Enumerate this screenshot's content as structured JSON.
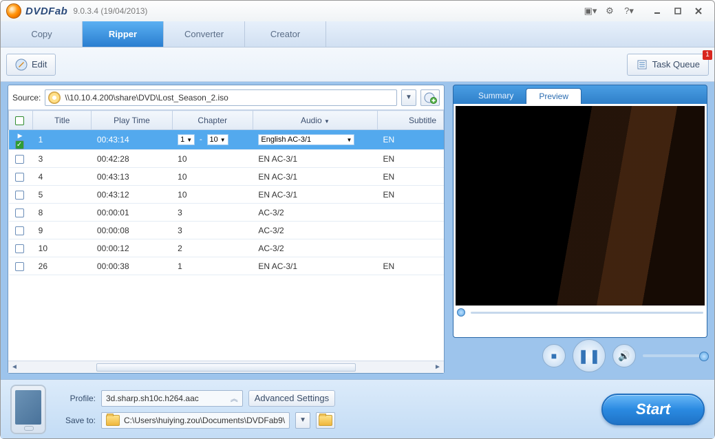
{
  "app": {
    "name": "DVDFab",
    "version": "9.0.3.4 (19/04/2013)"
  },
  "mainTabs": [
    "Copy",
    "Ripper",
    "Converter",
    "Creator"
  ],
  "activeMainTab": 1,
  "toolbar": {
    "edit": "Edit",
    "taskQueue": "Task Queue",
    "badge": "1"
  },
  "source": {
    "label": "Source:",
    "path": "\\\\10.10.4.200\\share\\DVD\\Lost_Season_2.iso"
  },
  "columns": [
    "Title",
    "Play Time",
    "Chapter",
    "Audio",
    "Subtitle"
  ],
  "rows": [
    {
      "sel": true,
      "checked": true,
      "title": "1",
      "play": "00:43:14",
      "chapFrom": "1",
      "chapTo": "10",
      "chapter": "",
      "audio": "English AC-3/1",
      "sub": "EN"
    },
    {
      "sel": false,
      "checked": false,
      "title": "3",
      "play": "00:42:28",
      "chapter": "10",
      "audio": "EN AC-3/1",
      "sub": "EN"
    },
    {
      "sel": false,
      "checked": false,
      "title": "4",
      "play": "00:43:13",
      "chapter": "10",
      "audio": "EN AC-3/1",
      "sub": "EN"
    },
    {
      "sel": false,
      "checked": false,
      "title": "5",
      "play": "00:43:12",
      "chapter": "10",
      "audio": "EN AC-3/1",
      "sub": "EN"
    },
    {
      "sel": false,
      "checked": false,
      "title": "8",
      "play": "00:00:01",
      "chapter": "3",
      "audio": " AC-3/2",
      "sub": ""
    },
    {
      "sel": false,
      "checked": false,
      "title": "9",
      "play": "00:00:08",
      "chapter": "3",
      "audio": " AC-3/2",
      "sub": ""
    },
    {
      "sel": false,
      "checked": false,
      "title": "10",
      "play": "00:00:12",
      "chapter": "2",
      "audio": " AC-3/2",
      "sub": ""
    },
    {
      "sel": false,
      "checked": false,
      "title": "26",
      "play": "00:00:38",
      "chapter": "1",
      "audio": "EN AC-3/1",
      "sub": "EN"
    }
  ],
  "preview": {
    "tabs": [
      "Summary",
      "Preview"
    ],
    "active": 1
  },
  "bottom": {
    "profileLabel": "Profile:",
    "profile": "3d.sharp.sh10c.h264.aac",
    "saveLabel": "Save to:",
    "savePath": "C:\\Users\\huiying.zou\\Documents\\DVDFab9\\",
    "advanced": "Advanced Settings",
    "start": "Start"
  }
}
